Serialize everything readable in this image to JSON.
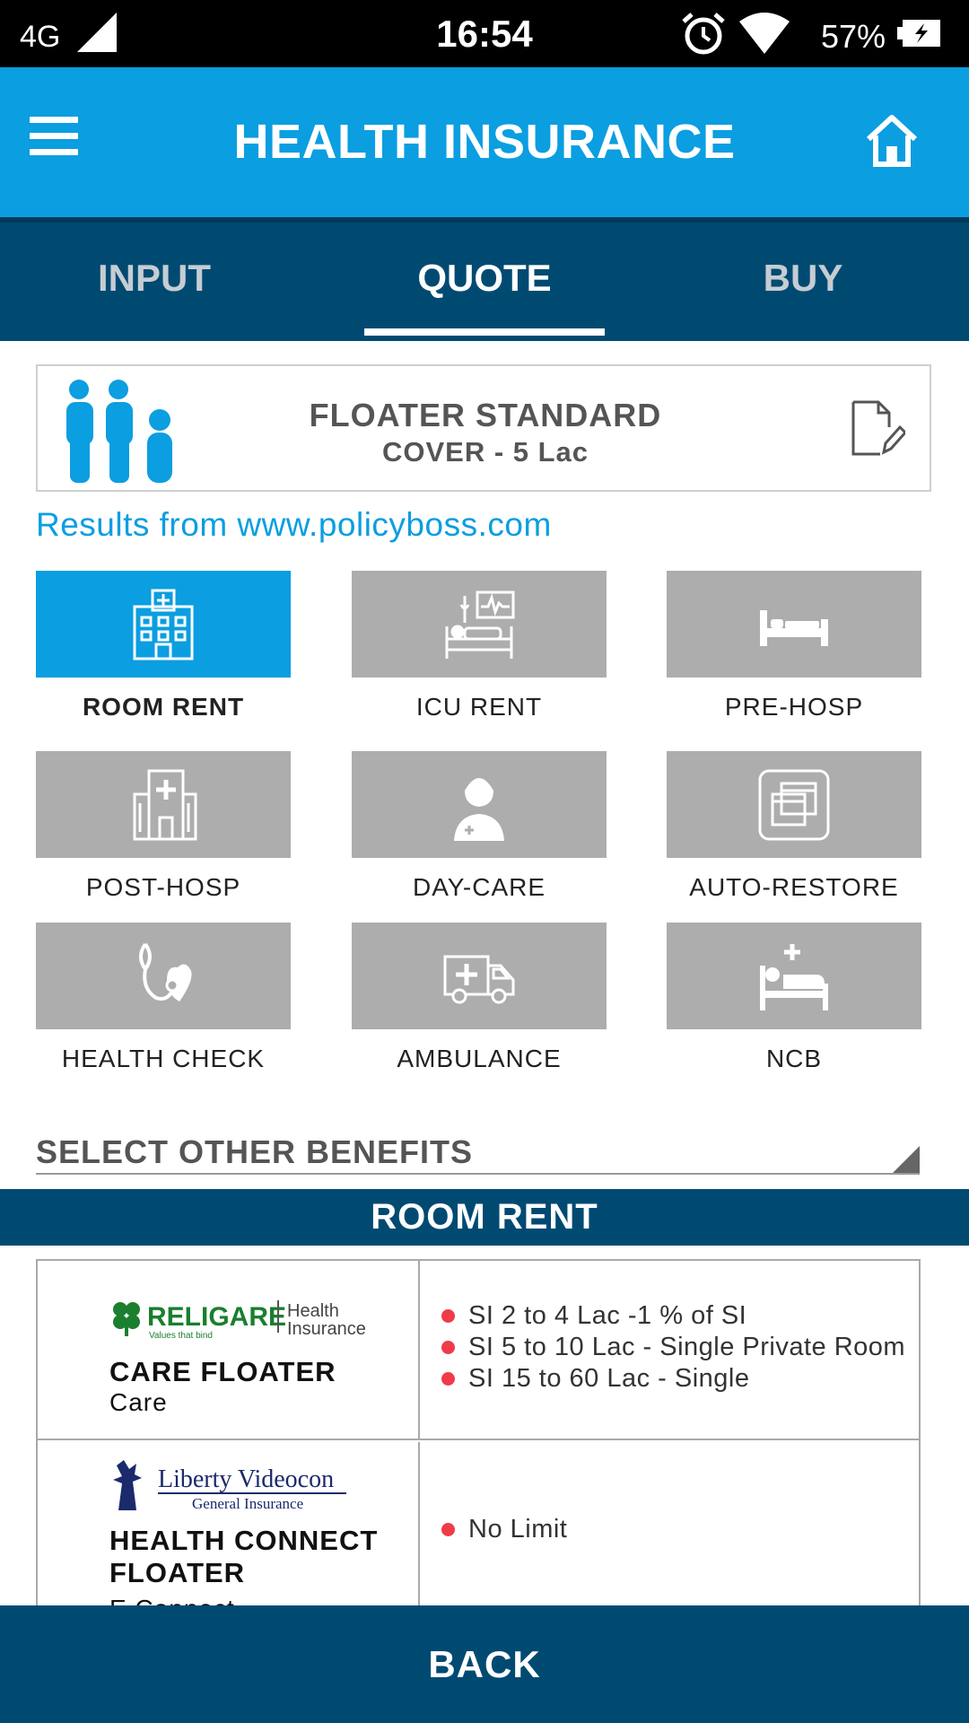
{
  "status_bar": {
    "network": "4G",
    "time": "16:54",
    "battery": "57%",
    "icons": [
      "signal-icon",
      "alarm-icon",
      "wifi-icon",
      "battery-charging-icon"
    ]
  },
  "header": {
    "title": "HEALTH INSURANCE",
    "icons": [
      "menu-icon",
      "home-icon"
    ]
  },
  "tabs": [
    {
      "label": "INPUT",
      "active": false
    },
    {
      "label": "QUOTE",
      "active": true
    },
    {
      "label": "BUY",
      "active": false
    }
  ],
  "plan": {
    "name": "FLOATER STANDARD",
    "cover": "COVER - 5 Lac",
    "icons": [
      "family-icon",
      "edit-icon"
    ]
  },
  "results_source": "Results from www.policyboss.com",
  "benefits": [
    {
      "label": "ROOM RENT",
      "icon": "hospital-building-icon",
      "selected": true
    },
    {
      "label": "ICU RENT",
      "icon": "icu-bed-icon",
      "selected": false
    },
    {
      "label": "PRE-HOSP",
      "icon": "bed-icon",
      "selected": false
    },
    {
      "label": "POST-HOSP",
      "icon": "clinic-icon",
      "selected": false
    },
    {
      "label": "DAY-CARE",
      "icon": "nurse-icon",
      "selected": false
    },
    {
      "label": "AUTO-RESTORE",
      "icon": "restore-window-icon",
      "selected": false
    },
    {
      "label": "HEALTH CHECK",
      "icon": "stethoscope-heart-icon",
      "selected": false
    },
    {
      "label": "AMBULANCE",
      "icon": "ambulance-icon",
      "selected": false
    },
    {
      "label": "NCB",
      "icon": "patient-bed-icon",
      "selected": false
    }
  ],
  "other_benefits": {
    "label": "SELECT OTHER BENEFITS"
  },
  "section_title": "ROOM RENT",
  "results": [
    {
      "insurer_logo": {
        "brand": "RELIGARE",
        "tagline": "Values that bind",
        "division_line1": "Health",
        "division_line2": "Insurance"
      },
      "product": "CARE FLOATER",
      "sub": "Care",
      "details": [
        "SI 2 to 4 Lac -1 % of SI",
        "SI 5 to 10 Lac - Single Private Room",
        "SI 15 to 60 Lac - Single"
      ]
    },
    {
      "insurer_logo": {
        "brand": "Liberty Videocon",
        "tagline": "General Insurance"
      },
      "product": "HEALTH CONNECT FLOATER",
      "sub": "E Connect",
      "details": [
        "No Limit"
      ]
    }
  ],
  "colors": {
    "primary": "#0b9ee0",
    "dark": "#004a72",
    "tile_inactive": "#adadad",
    "bullet": "#ef3b4a",
    "religare_green": "#1a7f2e",
    "liberty_navy": "#1b2a6b"
  },
  "footer": {
    "back_label": "BACK"
  }
}
